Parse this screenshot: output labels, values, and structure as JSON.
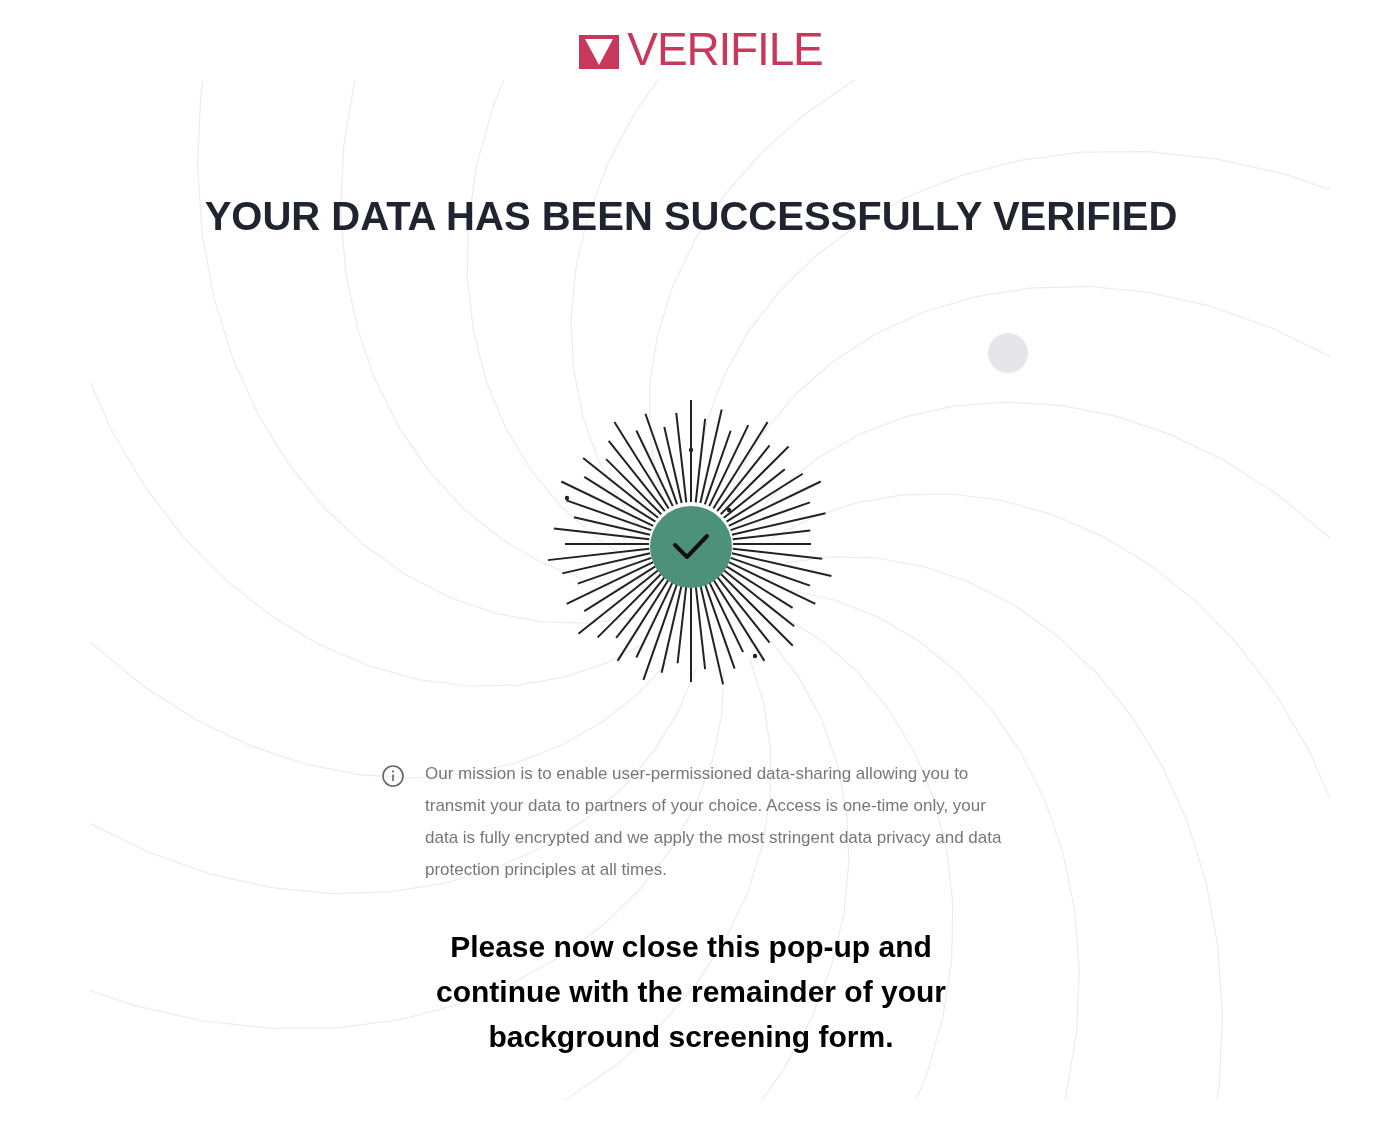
{
  "logo": {
    "text": "VERIFILE"
  },
  "heading": "YOUR DATA HAS BEEN SUCCESSFULLY VERIFIED",
  "status": {
    "verified": true
  },
  "info": "Our mission is to enable user-permissioned data-sharing allowing you to transmit your data to partners of your choice. Access is one-time only, your data is fully encrypted and we apply the most stringent data privacy and data protection principles at all times.",
  "instruction": "Please now close this pop-up and continue with the remainder of your background screening form."
}
